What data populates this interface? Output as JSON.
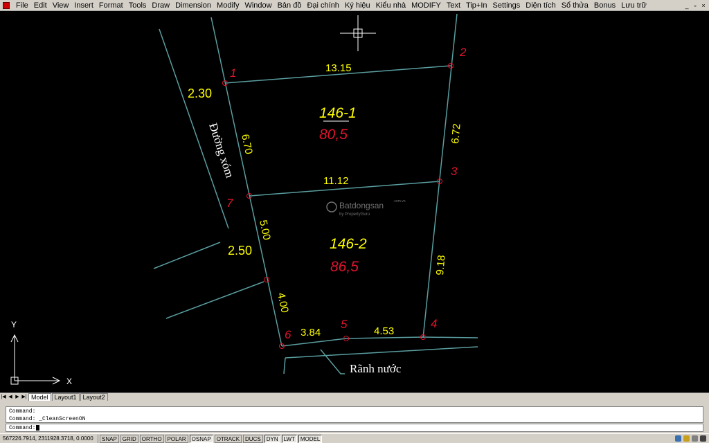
{
  "menu": [
    "File",
    "Edit",
    "View",
    "Insert",
    "Format",
    "Tools",
    "Draw",
    "Dimension",
    "Modify",
    "Window",
    "Bản đồ",
    "Đại chính",
    "Ký hiệu",
    "Kiểu nhà",
    "MODIFY",
    "Text",
    "Tip+In",
    "Settings",
    "Diện tích",
    "Sổ thửa",
    "Bonus",
    "Lưu trữ"
  ],
  "window_controls": {
    "minimize": "_",
    "restore": "▫",
    "close": "×"
  },
  "drawing": {
    "points": [
      "1",
      "2",
      "3",
      "4",
      "5",
      "6",
      "7"
    ],
    "edge_lengths": {
      "e1_2": "13.15",
      "e2_3": "6.72",
      "e3_7": "11.12",
      "e1_7": "6.70",
      "e7_8": "5.00",
      "e8_6": "4.00",
      "e6_5": "3.84",
      "e5_4": "4.53",
      "e4_3": "9.18",
      "road_top": "2.30",
      "road_bottom": "2.50"
    },
    "parcels": [
      {
        "id": "146-1",
        "area": "80,5"
      },
      {
        "id": "146-2",
        "area": "86,5"
      }
    ],
    "labels": {
      "road": "Đường xóm",
      "canal": "Rãnh nước"
    },
    "watermark": {
      "brand": "Batdongsan",
      "sub": "by PropertyGuru",
      "dom": ".com.vn"
    },
    "ucs": {
      "y": "Y",
      "x": "X"
    },
    "colors": {
      "lines": "#5a9ea0",
      "dims": "#ffff00",
      "points": "#e0142d",
      "area": "#e0142d",
      "text": "#ffffff"
    }
  },
  "tabs": {
    "model": "Model",
    "layout1": "Layout1",
    "layout2": "Layout2"
  },
  "command": {
    "history": [
      "Command:",
      "Command: _CleanScreenON"
    ],
    "prompt": "Command:"
  },
  "status": {
    "coords": "567226.7914, 2311928.3718, 0.0000",
    "buttons": [
      "SNAP",
      "GRID",
      "ORTHO",
      "POLAR",
      "OSNAP",
      "OTRACK",
      "DUCS",
      "DYN",
      "LWT",
      "MODEL"
    ],
    "on": [
      "OSNAP",
      "DYN",
      "LWT",
      "MODEL"
    ]
  }
}
